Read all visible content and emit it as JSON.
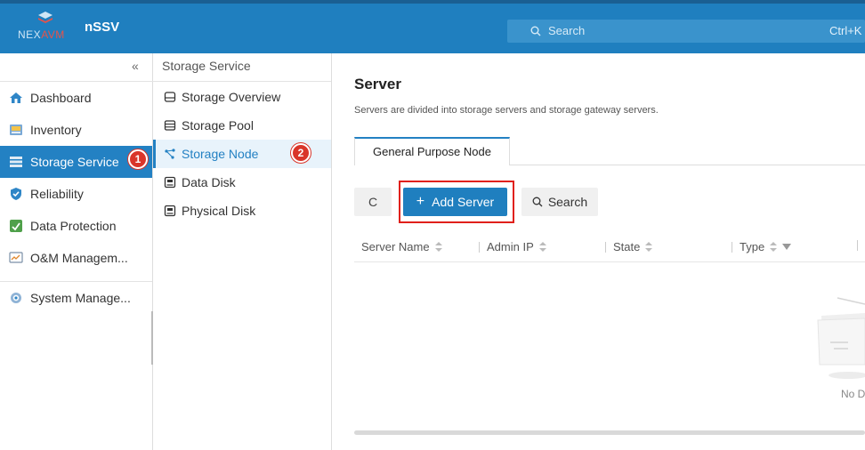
{
  "header": {
    "logo_text_a": "NEX",
    "logo_text_b": "AVM",
    "app_name": "nSSV",
    "search_placeholder": "Search",
    "search_shortcut": "Ctrl+K"
  },
  "sidebar": {
    "collapse_glyph": "«",
    "items": [
      {
        "label": "Dashboard",
        "icon": "house-icon"
      },
      {
        "label": "Inventory",
        "icon": "inventory-icon"
      },
      {
        "label": "Storage Service",
        "icon": "storage-icon",
        "active": true
      },
      {
        "label": "Reliability",
        "icon": "shield-icon"
      },
      {
        "label": "Data Protection",
        "icon": "data-protection-icon"
      },
      {
        "label": "O&M Managem...",
        "icon": "monitor-icon"
      },
      {
        "label": "System Manage...",
        "icon": "gear-icon"
      }
    ]
  },
  "subnav": {
    "title": "Storage Service",
    "items": [
      {
        "label": "Storage Overview",
        "icon": "overview-icon"
      },
      {
        "label": "Storage Pool",
        "icon": "pool-icon"
      },
      {
        "label": "Storage Node",
        "icon": "node-icon",
        "active": true
      },
      {
        "label": "Data Disk",
        "icon": "disk-icon"
      },
      {
        "label": "Physical Disk",
        "icon": "disk-icon"
      }
    ]
  },
  "callouts": {
    "one": "1",
    "two": "2"
  },
  "main": {
    "title": "Server",
    "description": "Servers are divided into storage servers and storage gateway servers.",
    "tab": "General Purpose Node",
    "toolbar": {
      "refresh_glyph": "C",
      "add_label": "Add Server",
      "search_label": "Search"
    },
    "columns": [
      "Server Name",
      "Admin IP",
      "State",
      "Type"
    ],
    "empty_text": "No D"
  },
  "colors": {
    "brand": "#1f7fbf",
    "active_nav": "#2381c3",
    "callout": "#d9352a",
    "highlight": "#e0201a"
  }
}
